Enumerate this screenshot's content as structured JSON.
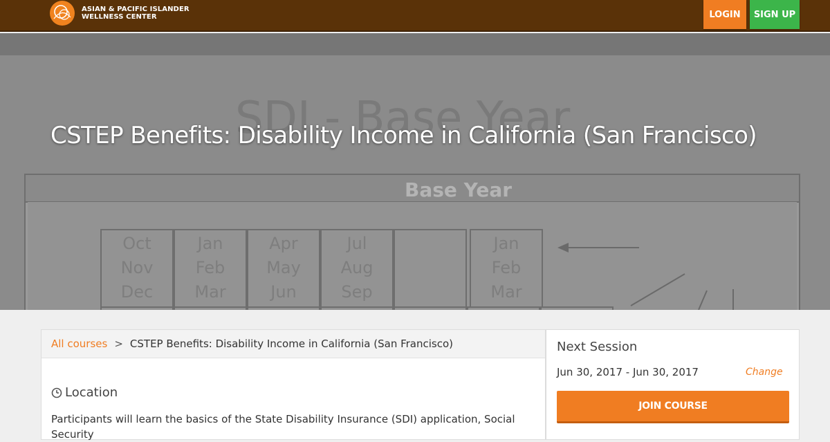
{
  "header": {
    "logo_line1": "ASIAN & PACIFIC ISLANDER",
    "logo_line2": "WELLNESS CENTER",
    "login_label": "LOGIN",
    "signup_label": "SIGN UP",
    "bg_color": "#5a3208",
    "login_color": "#f07d22",
    "signup_color": "#3cb54a"
  },
  "hero": {
    "title": "CSTEP Benefits: Disability Income in California (San Francisco)",
    "bg_heading": "SDI - Base Year",
    "bg_table_title": "Base Year",
    "bg_months": [
      [
        "Oct",
        "Nov",
        "Dec"
      ],
      [
        "Jan",
        "Feb",
        "Mar"
      ],
      [
        "Apr",
        "May",
        "Jun"
      ],
      [
        "Jul",
        "Aug",
        "Sep"
      ],
      [
        "",
        "",
        ""
      ],
      [
        "Jan",
        "Feb",
        "Mar"
      ]
    ]
  },
  "breadcrumb": {
    "link_label": "All courses",
    "separator": ">",
    "current": "CSTEP Benefits: Disability Income in California (San Francisco)"
  },
  "content": {
    "location_heading": "Location",
    "description": "Participants will learn the basics of the State Disability Insurance (SDI) application, Social Security"
  },
  "session": {
    "heading": "Next Session",
    "dates": "Jun 30, 2017 - Jun 30, 2017",
    "change_label": "Change",
    "join_label": "JOIN COURSE"
  },
  "accent_color": "#f07d22"
}
